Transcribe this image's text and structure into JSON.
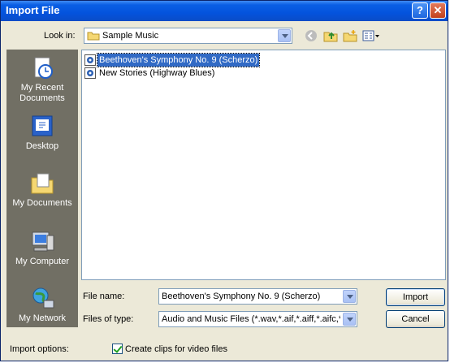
{
  "window": {
    "title": "Import File"
  },
  "look_in": {
    "label": "Look in:",
    "value": "Sample Music"
  },
  "places": [
    {
      "label_line1": "My Recent",
      "label_line2": "Documents",
      "icon": "recent-documents-icon"
    },
    {
      "label_line1": "Desktop",
      "label_line2": "",
      "icon": "desktop-icon"
    },
    {
      "label_line1": "My Documents",
      "label_line2": "",
      "icon": "my-documents-icon"
    },
    {
      "label_line1": "My Computer",
      "label_line2": "",
      "icon": "my-computer-icon"
    },
    {
      "label_line1": "My Network",
      "label_line2": "",
      "icon": "my-network-icon"
    }
  ],
  "files": [
    {
      "name": "Beethoven's Symphony No. 9 (Scherzo)",
      "selected": true
    },
    {
      "name": "New Stories (Highway Blues)",
      "selected": false
    }
  ],
  "file_name": {
    "label": "File name:",
    "value": "Beethoven's Symphony No. 9 (Scherzo)"
  },
  "file_type": {
    "label": "Files of type:",
    "value": "Audio and Music Files (*.wav,*.aif,*.aiff,*.aifc,*.s"
  },
  "buttons": {
    "import": "Import",
    "cancel": "Cancel"
  },
  "import_options": {
    "label": "Import options:",
    "checkbox_label": "Create clips for video files",
    "checked": true
  }
}
